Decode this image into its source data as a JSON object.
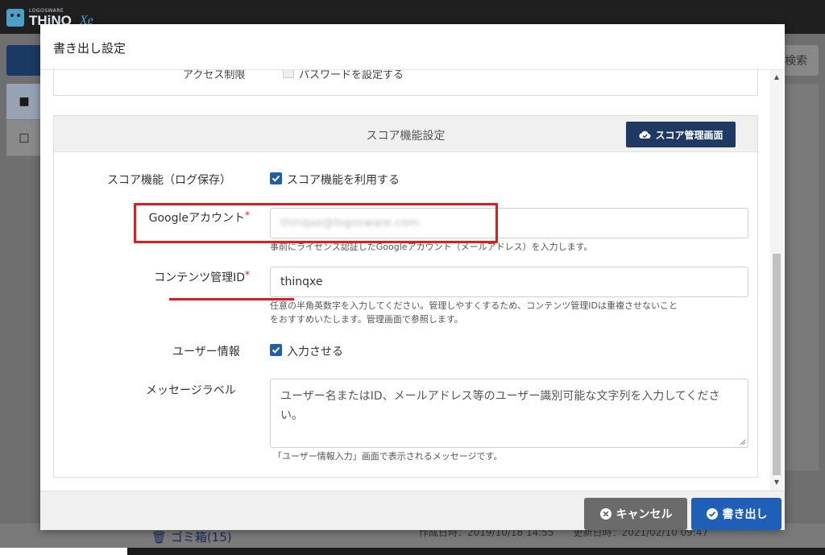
{
  "app": {
    "logo_small": "LOGOSWARE",
    "logo_name": "THiNQ",
    "logo_suffix": "Xe",
    "search_label": "検索",
    "trash_label": "ゴミ箱(15)",
    "dates_text": "作成日時：2019/10/18 14:55　　更新日時：2021/02/10 09:47"
  },
  "modal": {
    "title": "書き出し設定",
    "prev_section": {
      "label": "アクセス制限",
      "checkbox_text": "パスワードを設定する"
    },
    "score_section": {
      "title": "スコア機能設定",
      "mgmt_button": "スコア管理画面",
      "score_feature": {
        "label": "スコア機能（ログ保存）",
        "checkbox_text": "スコア機能を利用する",
        "checked": true
      },
      "google_account": {
        "label": "Googleアカウント",
        "required": "*",
        "value": "thinqxe@logosware.com",
        "help": "事前にライセンス認証したGoogleアカウント（メールアドレス）を入力します。"
      },
      "content_id": {
        "label": "コンテンツ管理ID",
        "required": "*",
        "value": "thinqxe",
        "help_line1": "任意の半角英数字を入力してください。管理しやすくするため、コンテンツ管理IDは重複させないこと",
        "help_line2": "をおすすめいたします。管理画面で参照します。"
      },
      "user_info": {
        "label": "ユーザー情報",
        "checkbox_text": "入力させる",
        "checked": true
      },
      "message_label": {
        "label": "メッセージラベル",
        "value": "ユーザー名またはID、メールアドレス等のユーザー識別可能な文字列を入力してください。",
        "help": "「ユーザー情報入力」画面で表示されるメッセージです。"
      }
    },
    "footer": {
      "cancel": "キャンセル",
      "export": "書き出し"
    }
  },
  "colors": {
    "primary": "#1f5fb8",
    "navy": "#1f3a62",
    "highlight": "#e21b1b",
    "cancel": "#6b6b6b"
  }
}
